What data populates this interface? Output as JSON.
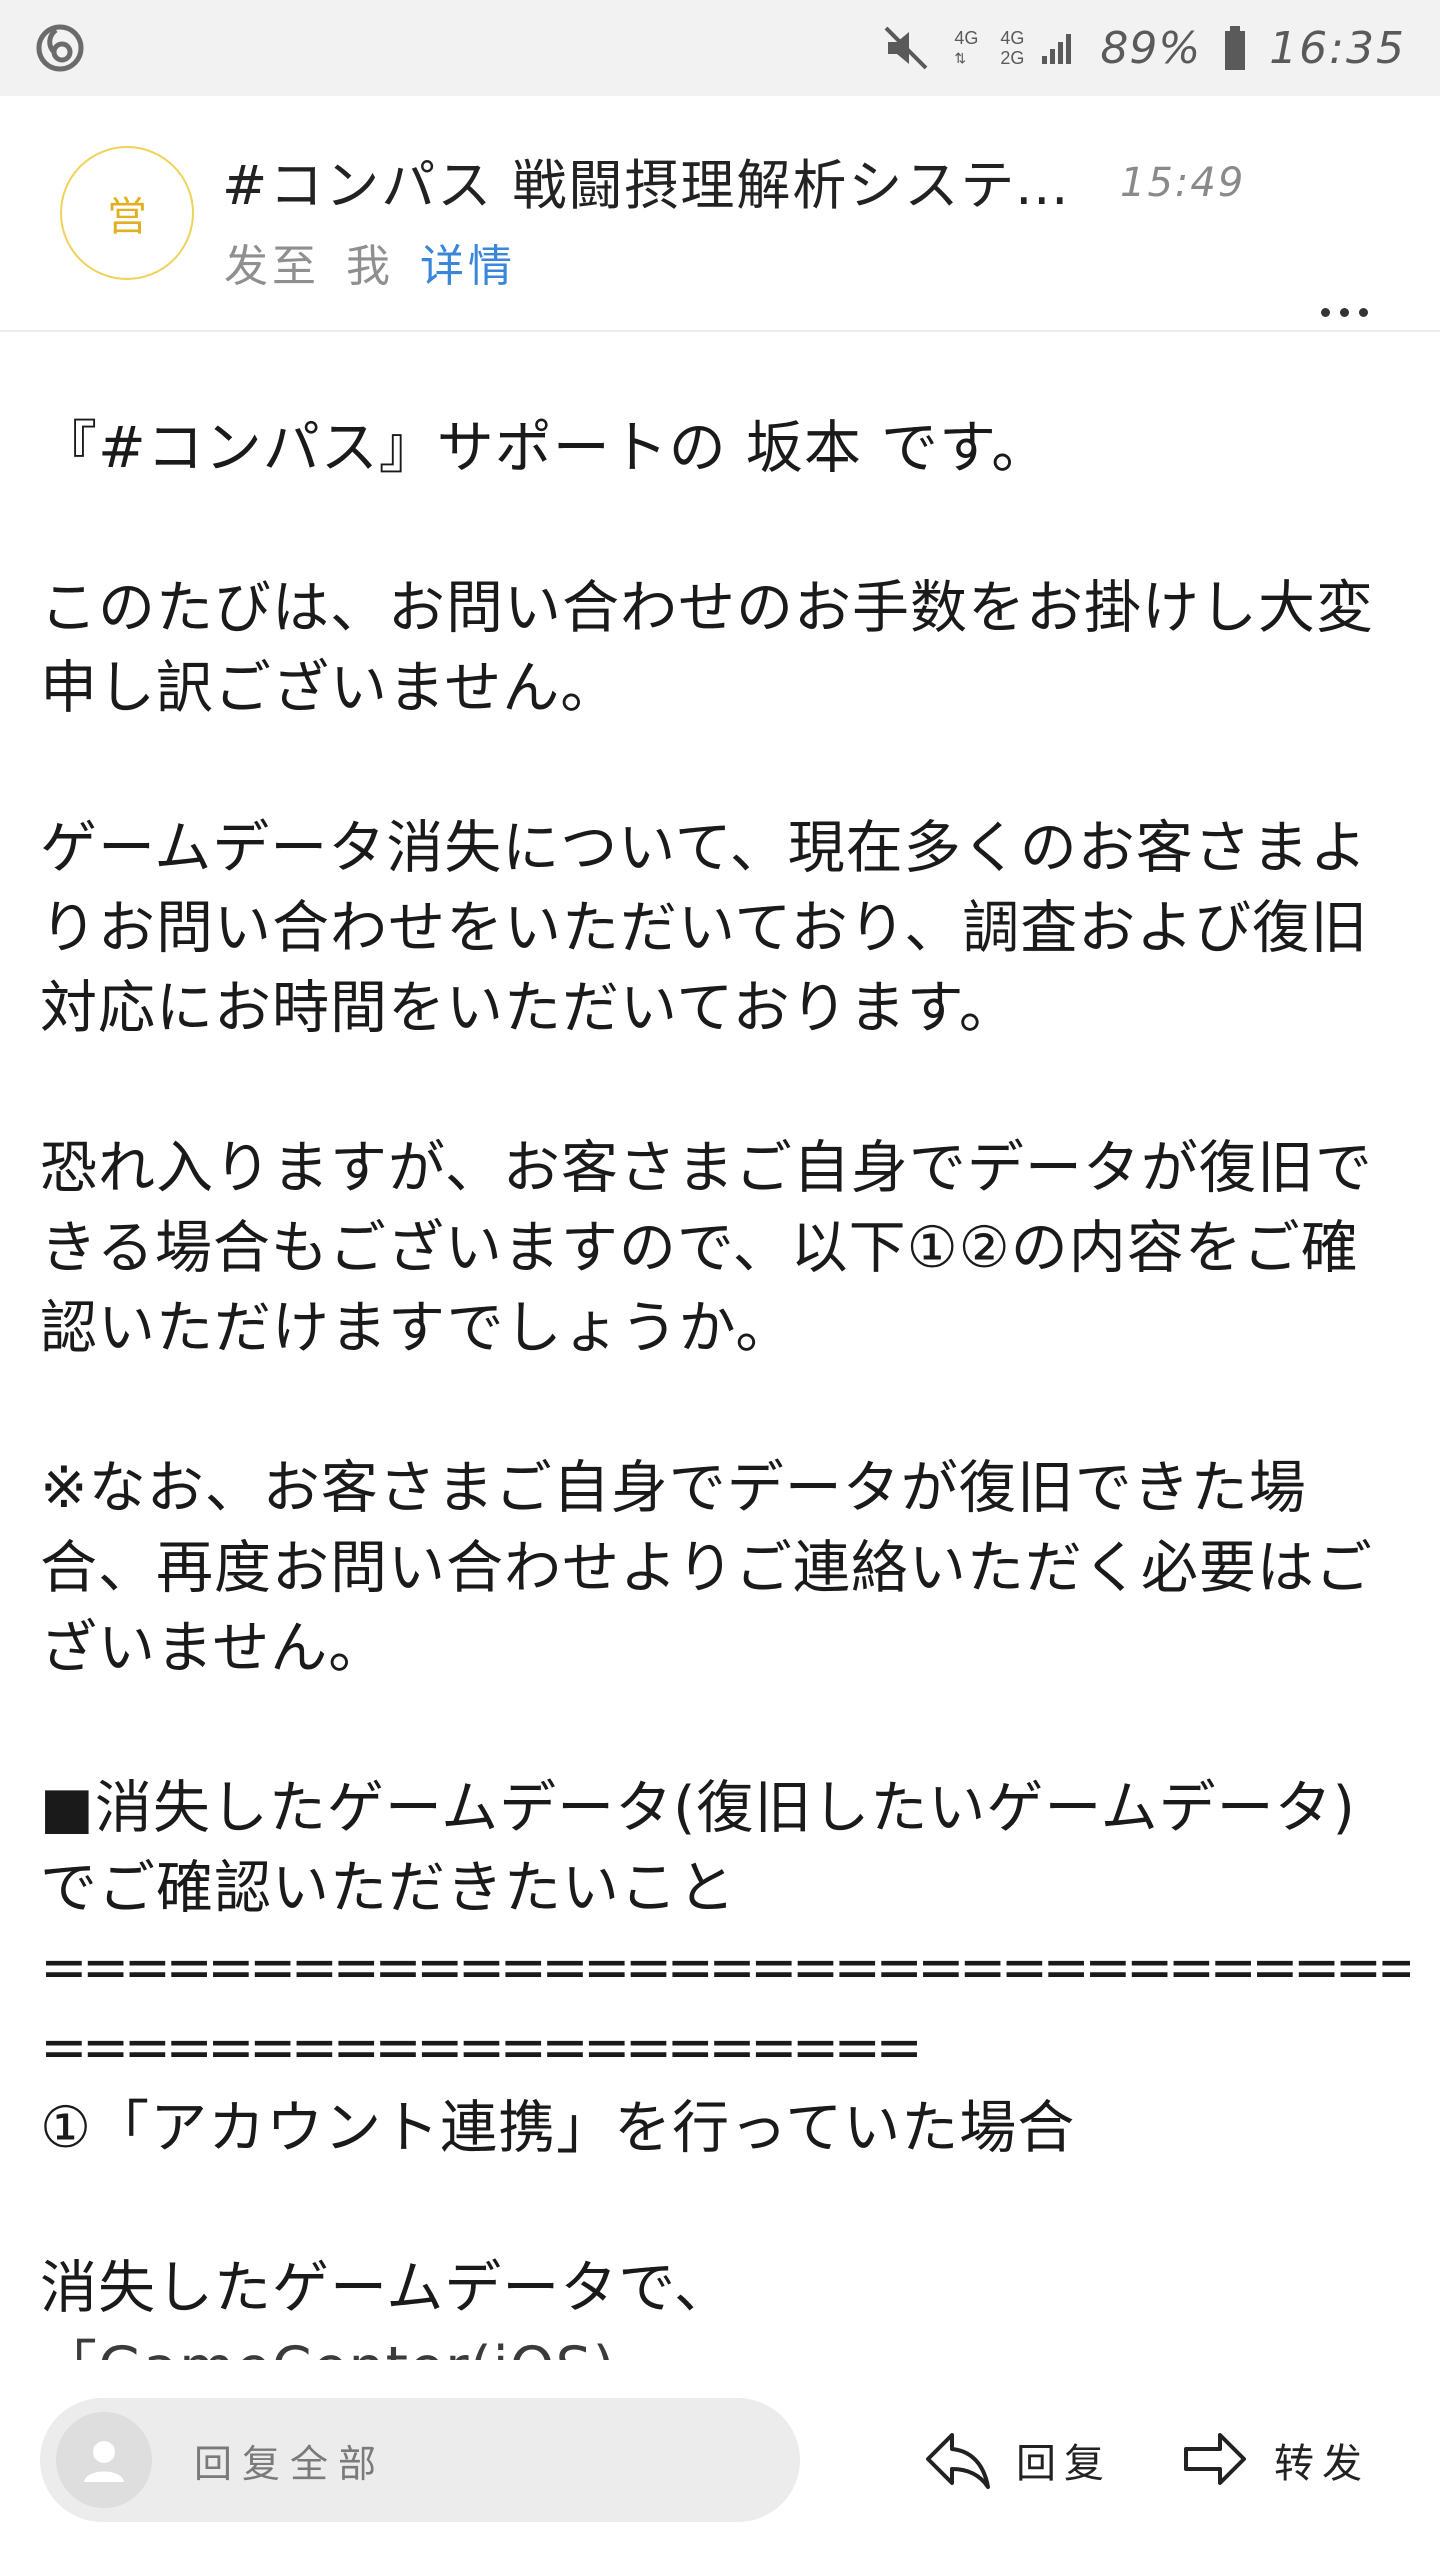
{
  "status_bar": {
    "app_logo_icon": "netease-mail-logo-icon",
    "mute_icon": "mute-icon",
    "network_top": "4G",
    "network_mid_a": "4G",
    "network_mid_b": "2G",
    "battery": "89%",
    "time": "16:35"
  },
  "header": {
    "avatar_char": "営",
    "subject": "#コンパス 戦闘摂理解析システム",
    "time": "15:49",
    "sent_to_label": "发至",
    "recipient": "我",
    "details_label": "详情",
    "more_icon": "more-dots-icon"
  },
  "body": {
    "paragraphs": [
      "『#コンパス』サポートの 坂本 です。",
      "このたびは、お問い合わせのお手数をお掛けし大変申し訳ございません。",
      "ゲームデータ消失について、現在多くのお客さまよりお問い合わせをいただいており、調査および復旧対応にお時間をいただいております。",
      "恐れ入りますが、お客さまご自身でデータが復旧できる場合もございますので、以下①②の内容をご確認いただけますでしょうか。",
      "※なお、お客さまご自身でデータが復旧できた場合、再度お問い合わせよりご連絡いただく必要はございません。",
      "■消失したゲームデータ(復旧したいゲームデータ)でご確認いただきたいこと"
    ],
    "rule_long": "==========================================",
    "rule_short": "=====================",
    "section_1": "①「アカウント連携」を行っていた場合",
    "lost_data_line": "消失したゲームデータで、",
    "cut_line": "「GameCenter(iOS)"
  },
  "bottom_bar": {
    "reply_all_placeholder": "回复全部",
    "reply_label": "回复",
    "forward_label": "转发"
  }
}
